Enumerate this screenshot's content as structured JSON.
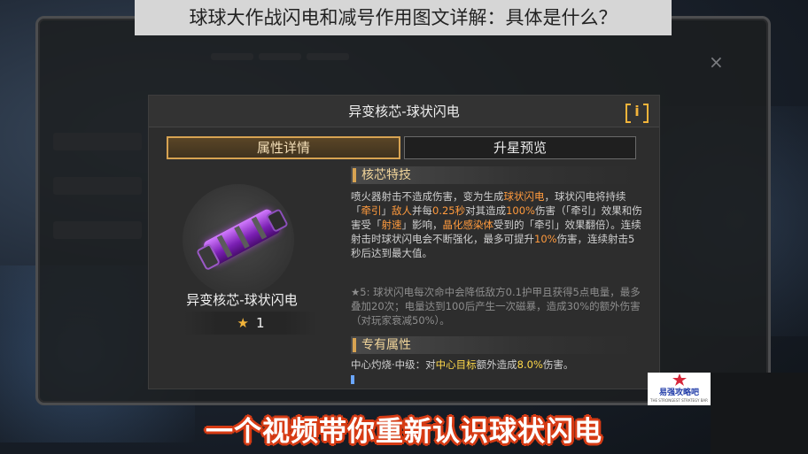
{
  "caption": "球球大作战闪电和减号作用图文详解：具体是什么？",
  "background": {
    "tabs": [
      "",
      "",
      ""
    ],
    "close_glyph": "×"
  },
  "dialog": {
    "title": "异变核芯-球状闪电",
    "info_icon": "info-icon",
    "info_glyph": "i",
    "tabs": [
      {
        "label": "属性详情",
        "active": true
      },
      {
        "label": "升星预览",
        "active": false
      }
    ],
    "item": {
      "name": "异变核芯-球状闪电",
      "star_glyph": "★",
      "star_count": "1"
    },
    "core_skill": {
      "heading": "核芯特技",
      "text_parts": [
        {
          "t": "喷火器射击不造成伤害，变为生成",
          "c": ""
        },
        {
          "t": "球状闪电",
          "c": "orange"
        },
        {
          "t": "，球状闪电将持续「",
          "c": ""
        },
        {
          "t": "牵引",
          "c": "orange"
        },
        {
          "t": "」",
          "c": ""
        },
        {
          "t": "敌人",
          "c": "orange"
        },
        {
          "t": "并每",
          "c": ""
        },
        {
          "t": "0.25秒",
          "c": "orange"
        },
        {
          "t": "对其造成",
          "c": ""
        },
        {
          "t": "100%",
          "c": "orange"
        },
        {
          "t": "伤害（「牵引」效果和伤害受「",
          "c": ""
        },
        {
          "t": "射速",
          "c": "orange"
        },
        {
          "t": "」影响，",
          "c": ""
        },
        {
          "t": "晶化感染体",
          "c": "orange"
        },
        {
          "t": "受到的「牵引」效果翻倍）。连续射击时球状闪电会不断强化，最多可提升",
          "c": ""
        },
        {
          "t": "10%",
          "c": "orange"
        },
        {
          "t": "伤害，连续射击5秒后达到最大值。",
          "c": ""
        }
      ],
      "star_note": "★5: 球状闪电每次命中会降低敌方0.1护甲且获得5点电量，最多叠加20次；电量达到100后产生一次磁暴，造成30%的额外伤害（对玩家衰减50%）。"
    },
    "exclusive": {
      "heading": "专有属性",
      "text_parts": [
        {
          "t": "中心灼烧·中级：对",
          "c": ""
        },
        {
          "t": "中心目标",
          "c": "yellow"
        },
        {
          "t": "额外造成",
          "c": ""
        },
        {
          "t": "8.0%",
          "c": "yellow"
        },
        {
          "t": "伤害。",
          "c": ""
        }
      ]
    }
  },
  "subtitle": "一个视频带你重新认识球状闪电",
  "watermark": {
    "name": "易强攻略吧",
    "sub": "THE STRONGEST STRATEGY BAR"
  },
  "colors": {
    "accent_gold": "#d7a352",
    "highlight_orange": "#ff9a3d",
    "highlight_yellow": "#ffd94a",
    "subtitle_outline": "#d63b14"
  }
}
